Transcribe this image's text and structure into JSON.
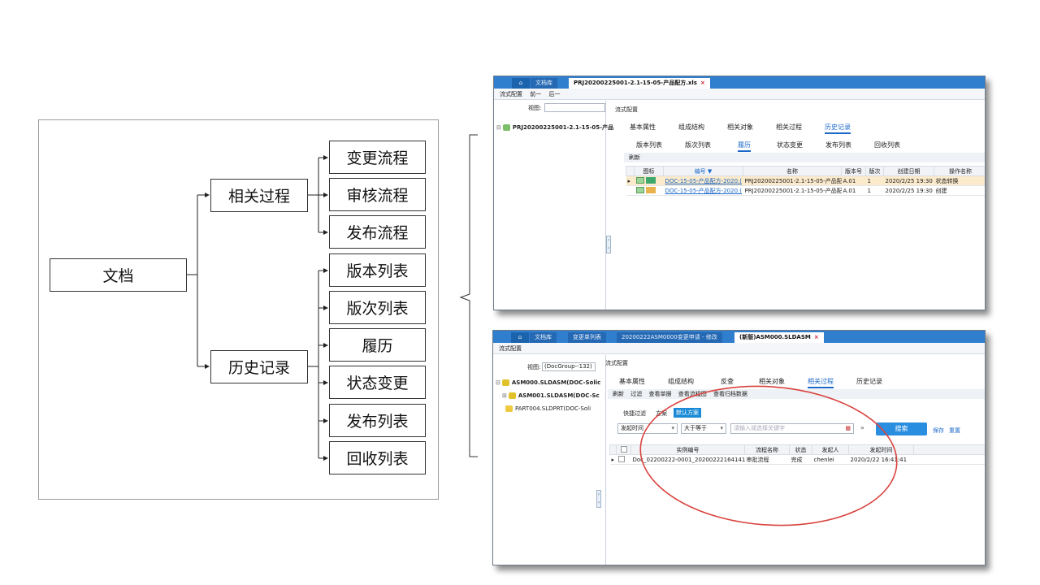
{
  "diagram": {
    "root": "文档",
    "branches": [
      {
        "label": "相关过程",
        "children": [
          "变更流程",
          "审核流程",
          "发布流程"
        ]
      },
      {
        "label": "历史记录",
        "children": [
          "版本列表",
          "版次列表",
          "履历",
          "状态变更",
          "发布列表",
          "回收列表"
        ]
      }
    ]
  },
  "screenshot1": {
    "tabs": [
      "⌂",
      "文档库",
      "PRJ20200225001-2.1-15-05-产品配方.xls"
    ],
    "tab_close": "×",
    "menu": [
      "流式配置",
      "前一",
      "后一"
    ],
    "view_label": "视图:",
    "view_value": "",
    "tree_item": "PRJ20200225001-2.1-15-05-产品",
    "crumb": "流式配置",
    "main_tabs": [
      "基本属性",
      "组成结构",
      "相关对象",
      "相关过程",
      "历史记录"
    ],
    "sub_tabs": [
      "版本列表",
      "版次列表",
      "履历",
      "状态变更",
      "发布列表",
      "回收列表"
    ],
    "toolbar": [
      "刷新"
    ],
    "columns": [
      "",
      "图标",
      "编号 ▼",
      "名称",
      "版本号",
      "版次",
      "创建日期",
      "操作名称"
    ],
    "rows": [
      [
        "▸",
        "",
        "DOC-15-05-产品配方-2020.(",
        "PRJ20200225001-2.1-15-05-产品配",
        "A.01",
        "1",
        "2020/2/25 19:30",
        "状态转换"
      ],
      [
        "",
        "",
        "DOC-15-05-产品配方-2020.(",
        "PRJ20200225001-2.1-15-05-产品配",
        "A.01",
        "1",
        "2020/2/25 19:30",
        "创建"
      ]
    ]
  },
  "screenshot2": {
    "tabs": [
      "⌂",
      "文档库",
      "变更单列表",
      "20200222ASM0000变更申请 - 修改",
      "(新版)ASM000.SLDASM"
    ],
    "tab_close": "×",
    "menu": [
      "流式配置"
    ],
    "view_label": "视图:",
    "view_value": "(DocGroup--132)",
    "tree_items": [
      "ASM000.SLDASM(DOC-Solic",
      "ASM001.SLDASM(DOC-Sc",
      "PART004.SLDPRT(DOC-Soli"
    ],
    "crumb": "流式配置",
    "main_tabs": [
      "基本属性",
      "组成结构",
      "反查",
      "相关对象",
      "相关过程",
      "历史记录"
    ],
    "toolbar": [
      "刷新",
      "过滤",
      "查看单据",
      "查看流程图",
      "查看归档数据"
    ],
    "filter_tabs": [
      "快捷过滤",
      "方案",
      "默认方案"
    ],
    "filter_field": "发起时间",
    "filter_op": "大于等于",
    "filter_placeholder": "请输入或选择关键字",
    "search_label": "搜索",
    "save_label": "保存",
    "reset_label": "重置",
    "columns": [
      "",
      "",
      "实例编号",
      "流程名称",
      "状态",
      "发起人",
      "发起时间"
    ],
    "rows": [
      [
        "▸",
        "",
        "Doc_02200222-0001_20200222164141",
        "审批流程",
        "完成",
        "chenlei",
        "2020/2/22 16:41:41"
      ]
    ]
  },
  "colors": {
    "titlebar": "#2f7fce",
    "accent": "#1a68c8",
    "highlight": "#fbeacb",
    "annotation": "#d9433f"
  }
}
